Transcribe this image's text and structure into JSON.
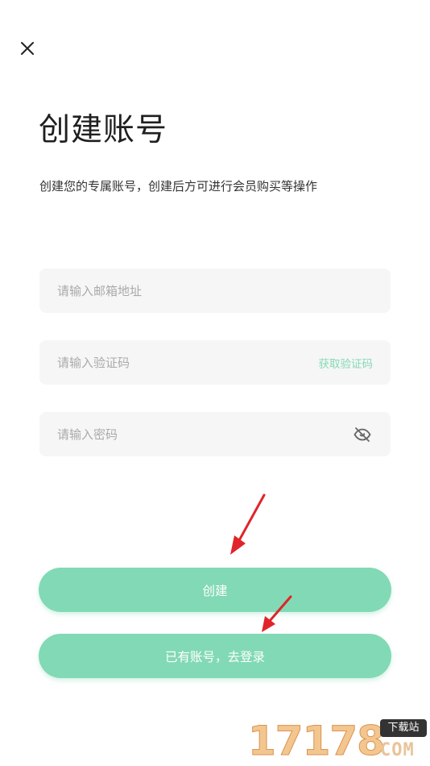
{
  "header": {
    "close_icon": "close-icon",
    "title": "创建账号",
    "subtitle": "创建您的专属账号，创建后方可进行会员购买等操作"
  },
  "form": {
    "email_placeholder": "请输入邮箱地址",
    "code_placeholder": "请输入验证码",
    "get_code_label": "获取验证码",
    "password_placeholder": "请输入密码",
    "password_toggle_icon": "eye-off-icon"
  },
  "actions": {
    "create_label": "创建",
    "login_label": "已有账号，去登录"
  },
  "annotations": {
    "arrow_icon": "red-arrow-icon"
  },
  "watermark": {
    "number": "17178",
    "tag": "下载站",
    "suffix": "COM"
  },
  "colors": {
    "accent": "#82d9b5",
    "accent_text": "#84d9b6",
    "field_bg": "#f6f6f6",
    "arrow": "#e0242a"
  }
}
